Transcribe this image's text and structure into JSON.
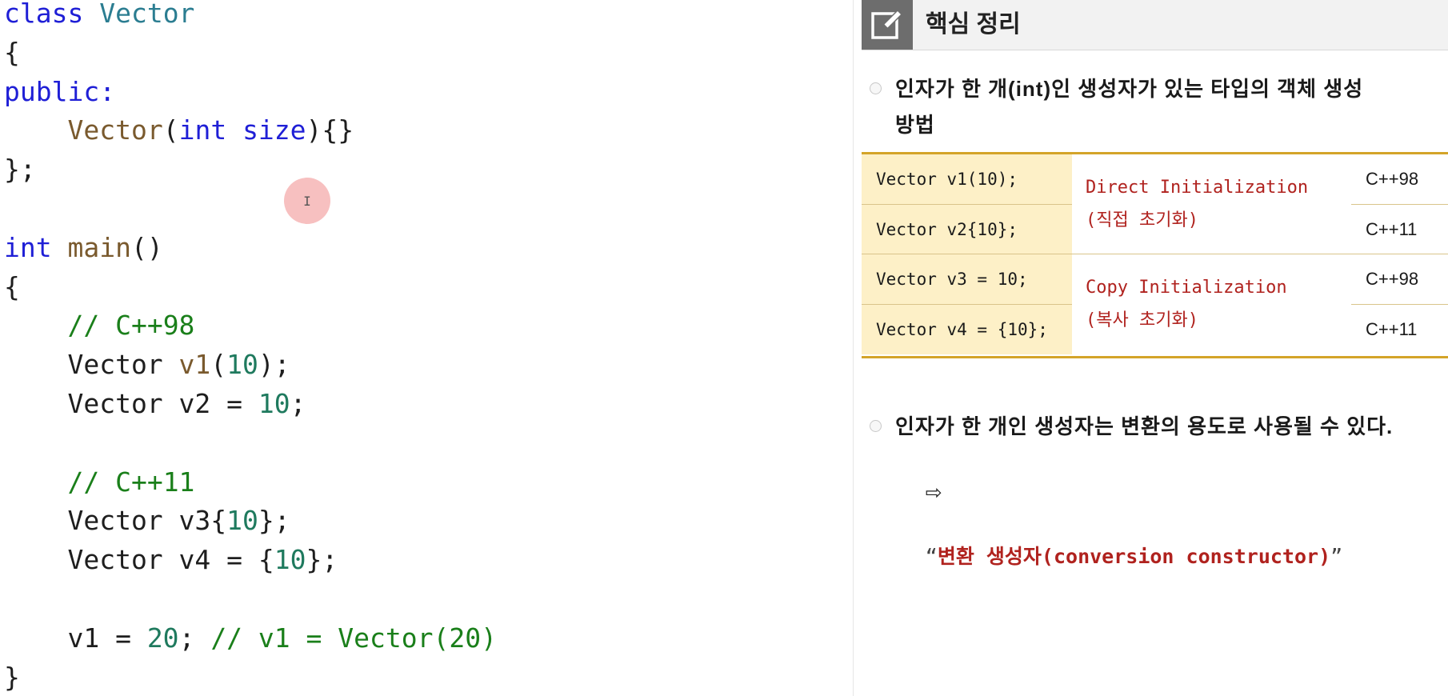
{
  "editor": {
    "lines": [
      [
        [
          "kw",
          "class "
        ],
        [
          "ty",
          "Vector"
        ]
      ],
      [
        [
          "pl",
          "{"
        ]
      ],
      [
        [
          "kw",
          "public:"
        ]
      ],
      [
        [
          "pl",
          "    "
        ],
        [
          "fn",
          "Vector"
        ],
        [
          "pl",
          "("
        ],
        [
          "kw",
          "int"
        ],
        [
          "pl",
          " "
        ],
        [
          "kw",
          "size"
        ],
        [
          "pl",
          "){}"
        ]
      ],
      [
        [
          "pl",
          "};"
        ]
      ],
      [],
      [
        [
          "kw",
          "int "
        ],
        [
          "fn",
          "main"
        ],
        [
          "pl",
          "()"
        ]
      ],
      [
        [
          "pl",
          "{"
        ]
      ],
      [
        [
          "pl",
          "    "
        ],
        [
          "cm",
          "// C++98"
        ]
      ],
      [
        [
          "pl",
          "    Vector "
        ],
        [
          "fn",
          "v1"
        ],
        [
          "pl",
          "("
        ],
        [
          "nm",
          "10"
        ],
        [
          "pl",
          ");"
        ]
      ],
      [
        [
          "pl",
          "    Vector v2 = "
        ],
        [
          "nm",
          "10"
        ],
        [
          "pl",
          ";"
        ]
      ],
      [],
      [
        [
          "pl",
          "    "
        ],
        [
          "cm",
          "// C++11"
        ]
      ],
      [
        [
          "pl",
          "    Vector v3{"
        ],
        [
          "nm",
          "10"
        ],
        [
          "pl",
          "};"
        ]
      ],
      [
        [
          "pl",
          "    Vector v4 = {"
        ],
        [
          "nm",
          "10"
        ],
        [
          "pl",
          "};"
        ]
      ],
      [],
      [
        [
          "pl",
          "    v1 = "
        ],
        [
          "nm",
          "20"
        ],
        [
          "pl",
          "; "
        ],
        [
          "cm",
          "// v1 = Vector(20)"
        ]
      ],
      [
        [
          "pl",
          "}"
        ]
      ]
    ],
    "cursor_glyph": "I"
  },
  "notes": {
    "title": "핵심 정리",
    "bullet1_line1": "인자가 한 개(int)인 생성자가 있는 타입의 객체 생성",
    "bullet1_line2": "방법",
    "table": {
      "rows": [
        {
          "code": "Vector v1(10);",
          "version": "C++98"
        },
        {
          "code": "Vector v2{10};",
          "version": "C++11"
        },
        {
          "code": "Vector v3 = 10;",
          "version": "C++98"
        },
        {
          "code": "Vector v4 = {10};",
          "version": "C++11"
        }
      ],
      "direct_label": "Direct Initialization",
      "direct_label_ko": "(직접 초기화)",
      "copy_label": "Copy Initialization",
      "copy_label_ko": "(복사 초기화)"
    },
    "bullet2": "인자가 한 개인 생성자는 변환의 용도로 사용될 수 있다.",
    "conversion_arrow": "⇨",
    "conversion_open_quote": "“",
    "conversion_text": "변환 생성자(conversion constructor)",
    "conversion_close_quote": "”",
    "colors": {
      "accent_red": "#b0221e",
      "table_border": "#d4a429",
      "table_fill": "#fdf0c7"
    }
  }
}
